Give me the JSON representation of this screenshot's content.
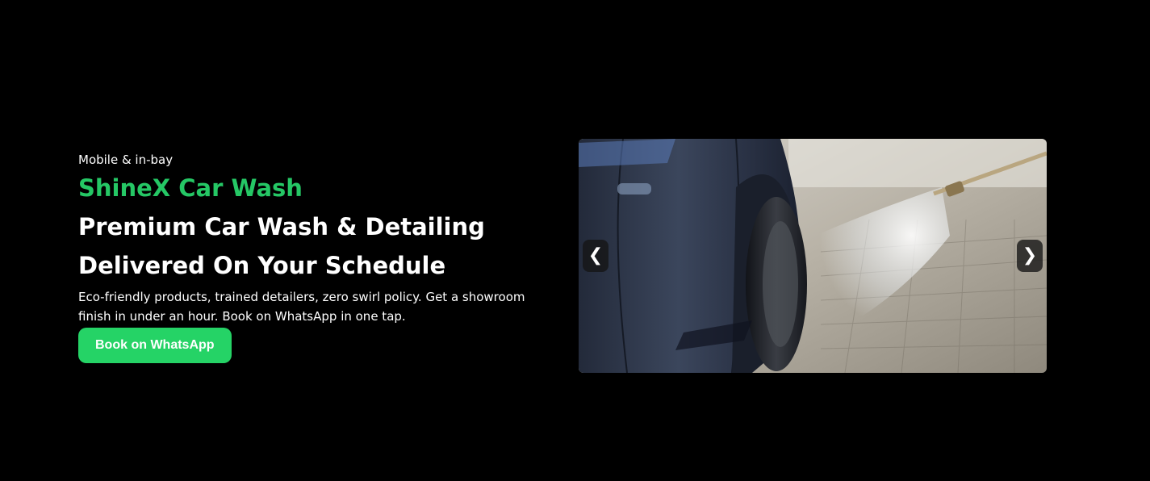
{
  "hero": {
    "eyebrow": "Mobile & in-bay",
    "brand": "ShineX Car Wash",
    "headline_line1": "Premium Car Wash & Detailing",
    "headline_line2": "Delivered On Your Schedule",
    "description": "Eco-friendly products, trained detailers, zero swirl policy. Get a showroom finish in under an hour. Book on WhatsApp in one tap.",
    "cta_label": "Book on WhatsApp"
  },
  "carousel": {
    "prev_label": "❮",
    "next_label": "❯",
    "slide_image": "car-pressure-wash-photo"
  },
  "colors": {
    "background": "#000000",
    "brand_green": "#25c765",
    "button_green": "#25d366",
    "text": "#ffffff"
  }
}
